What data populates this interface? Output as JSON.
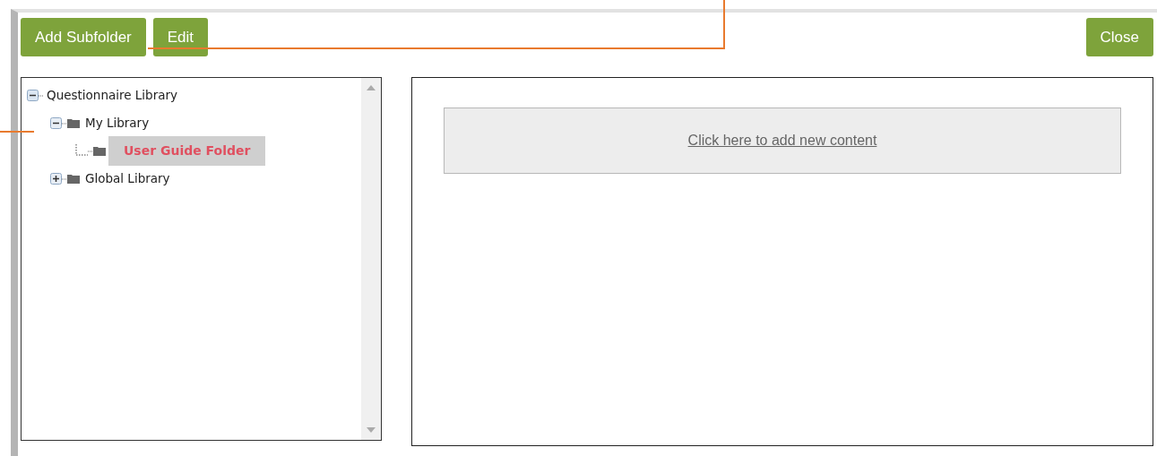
{
  "toolbar": {
    "left_buttons": [
      "Add Subfolder",
      "Edit"
    ],
    "right_buttons": [
      "Close"
    ]
  },
  "tree": [
    {
      "label": "Questionnaire Library",
      "kind": "root",
      "expanded": true,
      "selected": false,
      "children": [
        {
          "label": "My Library",
          "kind": "folder",
          "expanded": true,
          "selected": false,
          "children": [
            {
              "label": "User Guide Folder",
              "kind": "folder",
              "selected": true
            }
          ]
        },
        {
          "label": "Global Library",
          "kind": "folder",
          "expanded": false,
          "selected": false
        }
      ]
    }
  ],
  "content": {
    "add_link": "Click here to add new content"
  }
}
